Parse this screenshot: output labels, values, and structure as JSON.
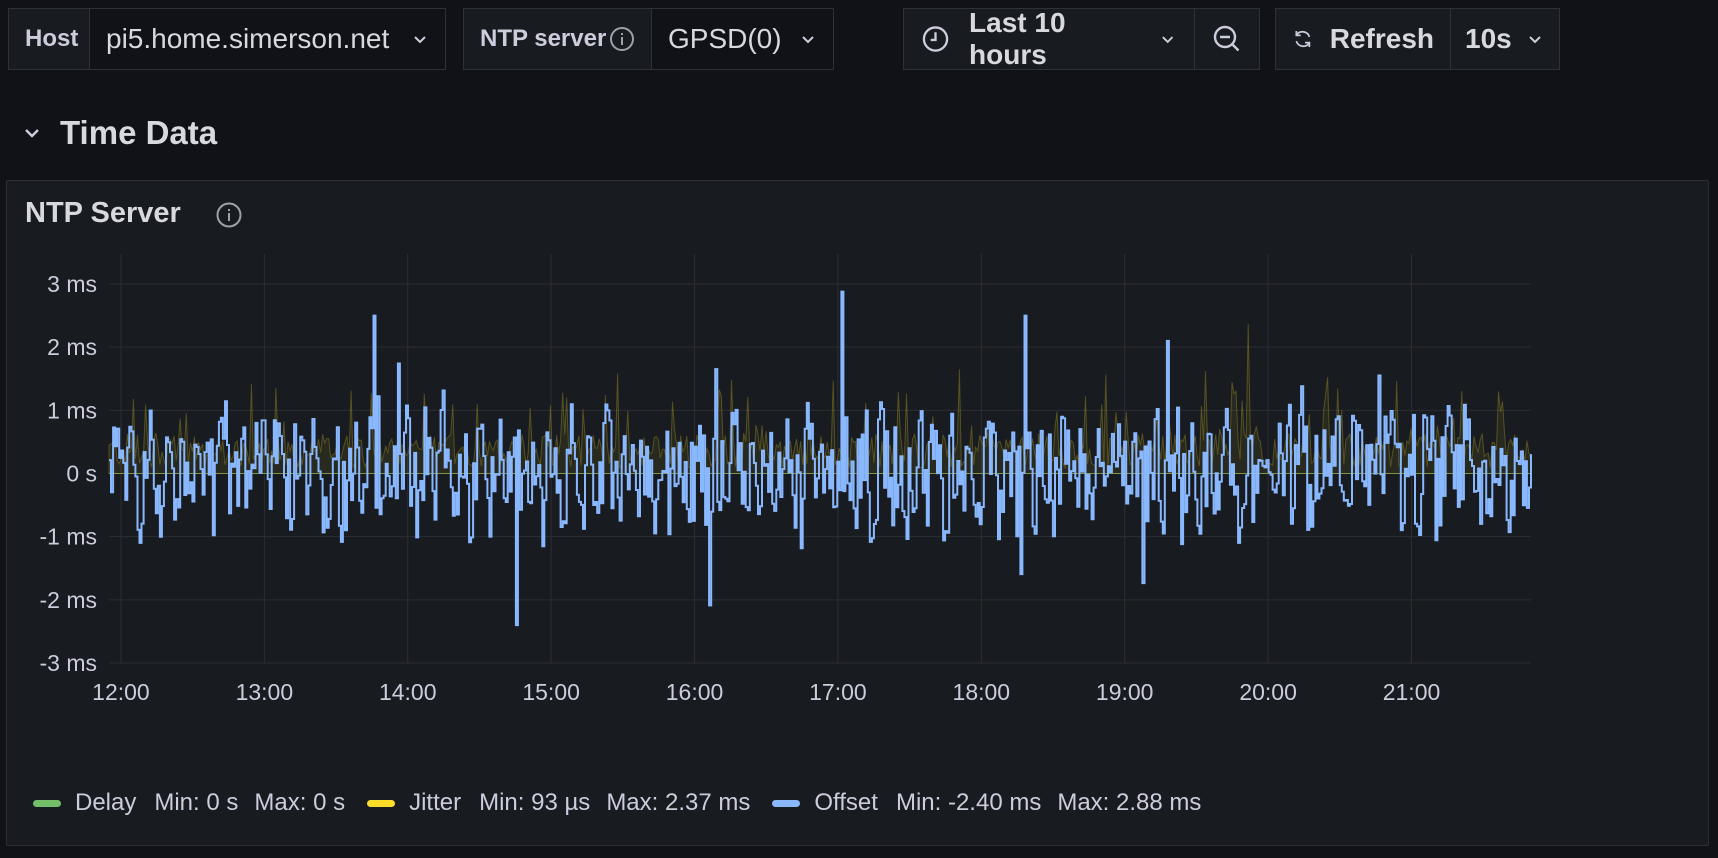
{
  "toolbar": {
    "host_label": "Host",
    "host_value": "pi5.home.simerson.net",
    "ntp_label": "NTP server",
    "ntp_value": "GPSD(0)",
    "time_range": "Last 10 hours",
    "refresh_label": "Refresh",
    "refresh_interval": "10s"
  },
  "section": {
    "title": "Time Data"
  },
  "panel": {
    "title": "NTP Server"
  },
  "colors": {
    "delay": "#73bf69",
    "jitter": "#fade2a",
    "offset": "#8ab8ff",
    "background": "#111217",
    "panel": "#181b1f"
  },
  "chart_data": {
    "type": "line",
    "x_labels": [
      "12:00",
      "13:00",
      "14:00",
      "15:00",
      "16:00",
      "17:00",
      "18:00",
      "19:00",
      "20:00",
      "21:00"
    ],
    "x_range": [
      "11:55",
      "21:50"
    ],
    "y_ticks": [
      "3 ms",
      "2 ms",
      "1 ms",
      "0 s",
      "-1 ms",
      "-2 ms",
      "-3 ms"
    ],
    "ylim_ms": [
      -3,
      3
    ],
    "grid": true,
    "legend_position": "bottom-left",
    "series": [
      {
        "name": "Delay",
        "color": "#73bf69",
        "min": "Min: 0 s",
        "max": "Max: 0 s",
        "constant_ms": 0
      },
      {
        "name": "Jitter",
        "color": "#fade2a",
        "min": "Min: 93 µs",
        "max": "Max: 2.37 ms",
        "min_ms": 0.093,
        "max_ms": 2.37
      },
      {
        "name": "Offset",
        "color": "#8ab8ff",
        "min": "Min: -2.40 ms",
        "max": "Max: 2.88 ms",
        "min_ms": -2.4,
        "max_ms": 2.88
      }
    ]
  }
}
